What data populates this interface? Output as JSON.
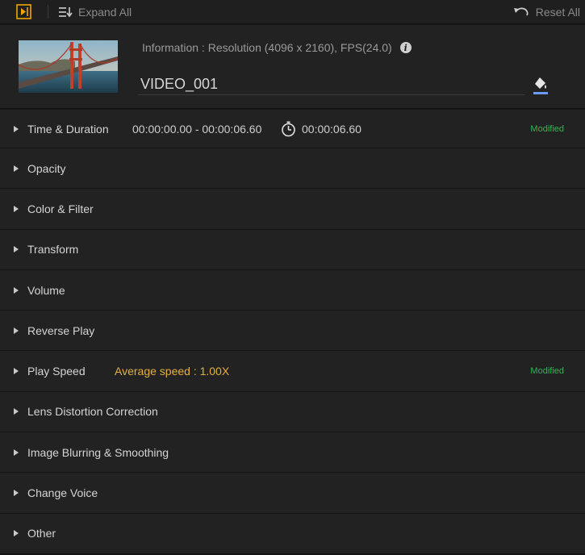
{
  "toolbar": {
    "expand_all_label": "Expand All",
    "reset_all_label": "Reset All"
  },
  "clip": {
    "information": "Information : Resolution (4096 x 2160), FPS(24.0)",
    "info_icon_glyph": "i",
    "name": "VIDEO_001"
  },
  "sections": [
    {
      "label": "Time & Duration",
      "range": "00:00:00.00 - 00:00:06.60",
      "duration": "00:00:06.60",
      "status": "Modified"
    },
    {
      "label": "Opacity"
    },
    {
      "label": "Color & Filter"
    },
    {
      "label": "Transform"
    },
    {
      "label": "Volume"
    },
    {
      "label": "Reverse Play"
    },
    {
      "label": "Play Speed",
      "speed": "Average speed : 1.00X",
      "status": "Modified"
    },
    {
      "label": "Lens Distortion Correction"
    },
    {
      "label": "Image Blurring & Smoothing"
    },
    {
      "label": "Change Voice"
    },
    {
      "label": "Other"
    }
  ],
  "colors": {
    "modified": "#2db84f",
    "speed": "#e3b23c",
    "accent": "#f0a500",
    "bucket_underline": "#6a9cff"
  },
  "icons": {
    "clip": "clip-properties-icon",
    "expand": "expand-all-icon",
    "reset": "undo-icon",
    "info": "info-icon",
    "bucket": "paint-bucket-icon",
    "timer": "stopwatch-icon",
    "caret": "caret-right-icon"
  }
}
